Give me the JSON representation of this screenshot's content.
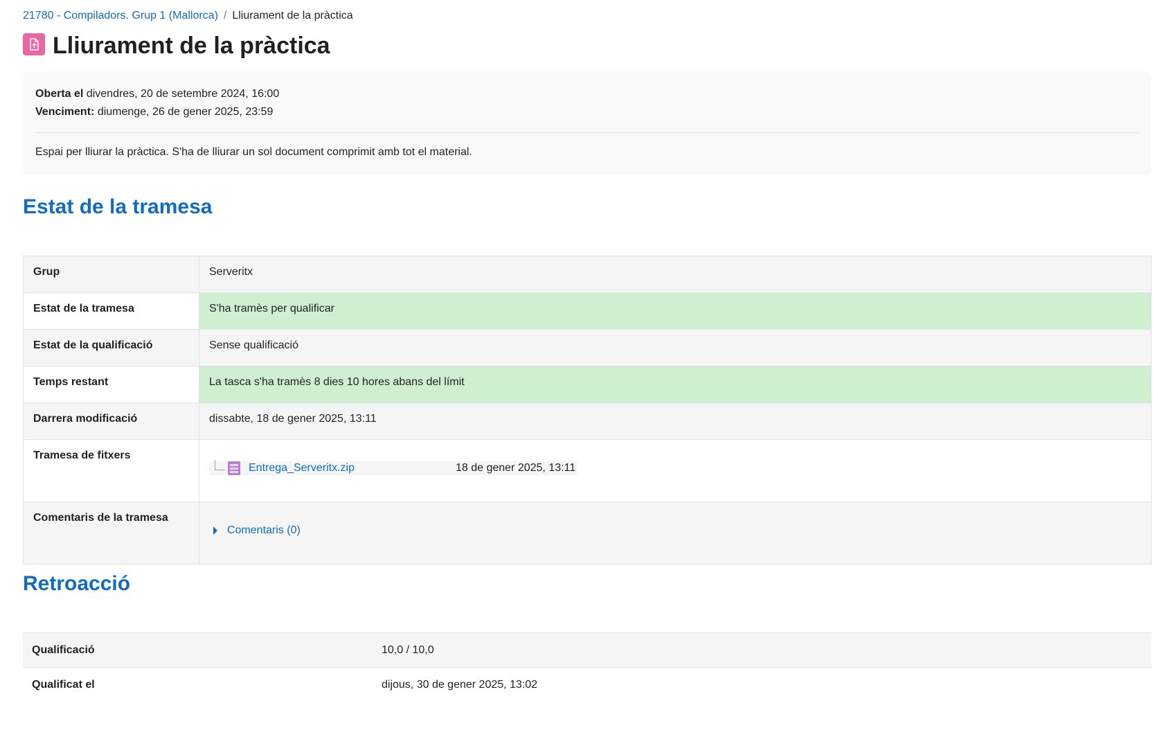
{
  "breadcrumb": {
    "course": "21780 - Compiladors. Grup 1 (Mallorca)",
    "separator": "/",
    "current": "Lliurament de la pràctica"
  },
  "header": {
    "title": "Lliurament de la pràctica",
    "icon": "assignment-icon",
    "icon_color": "#eb66a2"
  },
  "dates": {
    "opened_label": "Oberta el",
    "opened_value": "divendres, 20 de setembre 2024, 16:00",
    "due_label": "Venciment:",
    "due_value": "diumenge, 26 de gener 2025, 23:59"
  },
  "description": "Espai per lliurar la pràctica. S'ha de lliurar un sol document comprimit amb tot el material.",
  "submission_status": {
    "heading": "Estat de la tramesa",
    "group_label": "Grup",
    "group_value": "Serveritx",
    "status_label": "Estat de la tramesa",
    "status_value": "S'ha tramès per qualificar",
    "grading_label": "Estat de la qualificació",
    "grading_value": "Sense qualificació",
    "time_label": "Temps restant",
    "time_value": "La tasca s'ha tramès 8 dies 10 hores abans del límit",
    "modified_label": "Darrera modificació",
    "modified_value": "dissabte, 18 de gener 2025, 13:11",
    "files_label": "Tramesa de fitxers",
    "file_name": "Entrega_Serveritx.zip",
    "file_date": "18 de gener 2025, 13:11",
    "comments_label": "Comentaris de la tramesa",
    "comments_link": "Comentaris (0)",
    "success_color": "#d0efd0"
  },
  "feedback": {
    "heading": "Retroacció",
    "grade_label": "Qualificació",
    "grade_value": "10,0 / 10,0",
    "graded_on_label": "Qualificat el",
    "graded_on_value": "dijous, 30 de gener 2025, 13:02"
  },
  "colors": {
    "link": "#0f6cbf",
    "text": "#1d2125"
  }
}
